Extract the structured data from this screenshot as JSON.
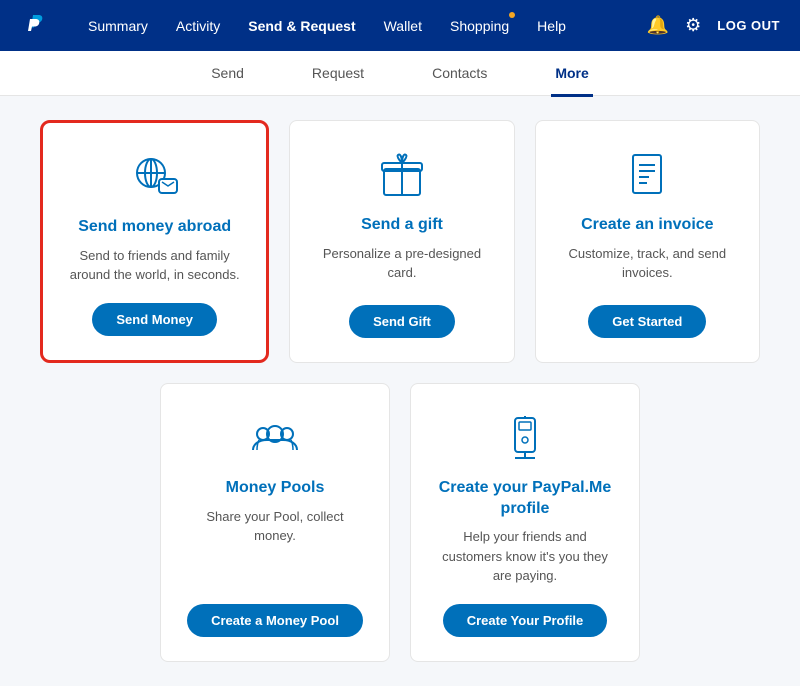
{
  "topNav": {
    "logoAlt": "PayPal",
    "links": [
      {
        "label": "Summary",
        "active": false
      },
      {
        "label": "Activity",
        "active": false
      },
      {
        "label": "Send & Request",
        "active": true
      },
      {
        "label": "Wallet",
        "active": false
      },
      {
        "label": "Shopping",
        "active": false,
        "dot": true
      },
      {
        "label": "Help",
        "active": false
      }
    ],
    "logoutLabel": "LOG OUT"
  },
  "subNav": {
    "links": [
      {
        "label": "Send",
        "active": false
      },
      {
        "label": "Request",
        "active": false
      },
      {
        "label": "Contacts",
        "active": false
      },
      {
        "label": "More",
        "active": true
      }
    ]
  },
  "cards": {
    "row1": [
      {
        "id": "send-abroad",
        "title": "Send money abroad",
        "desc": "Send to friends and family around the world, in seconds.",
        "btnLabel": "Send Money",
        "highlighted": true
      },
      {
        "id": "send-gift",
        "title": "Send a gift",
        "desc": "Personalize a pre-designed card.",
        "btnLabel": "Send Gift",
        "highlighted": false
      },
      {
        "id": "create-invoice",
        "title": "Create an invoice",
        "desc": "Customize, track, and send invoices.",
        "btnLabel": "Get Started",
        "highlighted": false
      }
    ],
    "row2": [
      {
        "id": "money-pools",
        "title": "Money Pools",
        "desc": "Share your Pool, collect money.",
        "btnLabel": "Create a Money Pool",
        "highlighted": false
      },
      {
        "id": "paypalme",
        "title": "Create your PayPal.Me profile",
        "desc": "Help your friends and customers know it's you they are paying.",
        "btnLabel": "Create Your Profile",
        "highlighted": false
      }
    ]
  }
}
